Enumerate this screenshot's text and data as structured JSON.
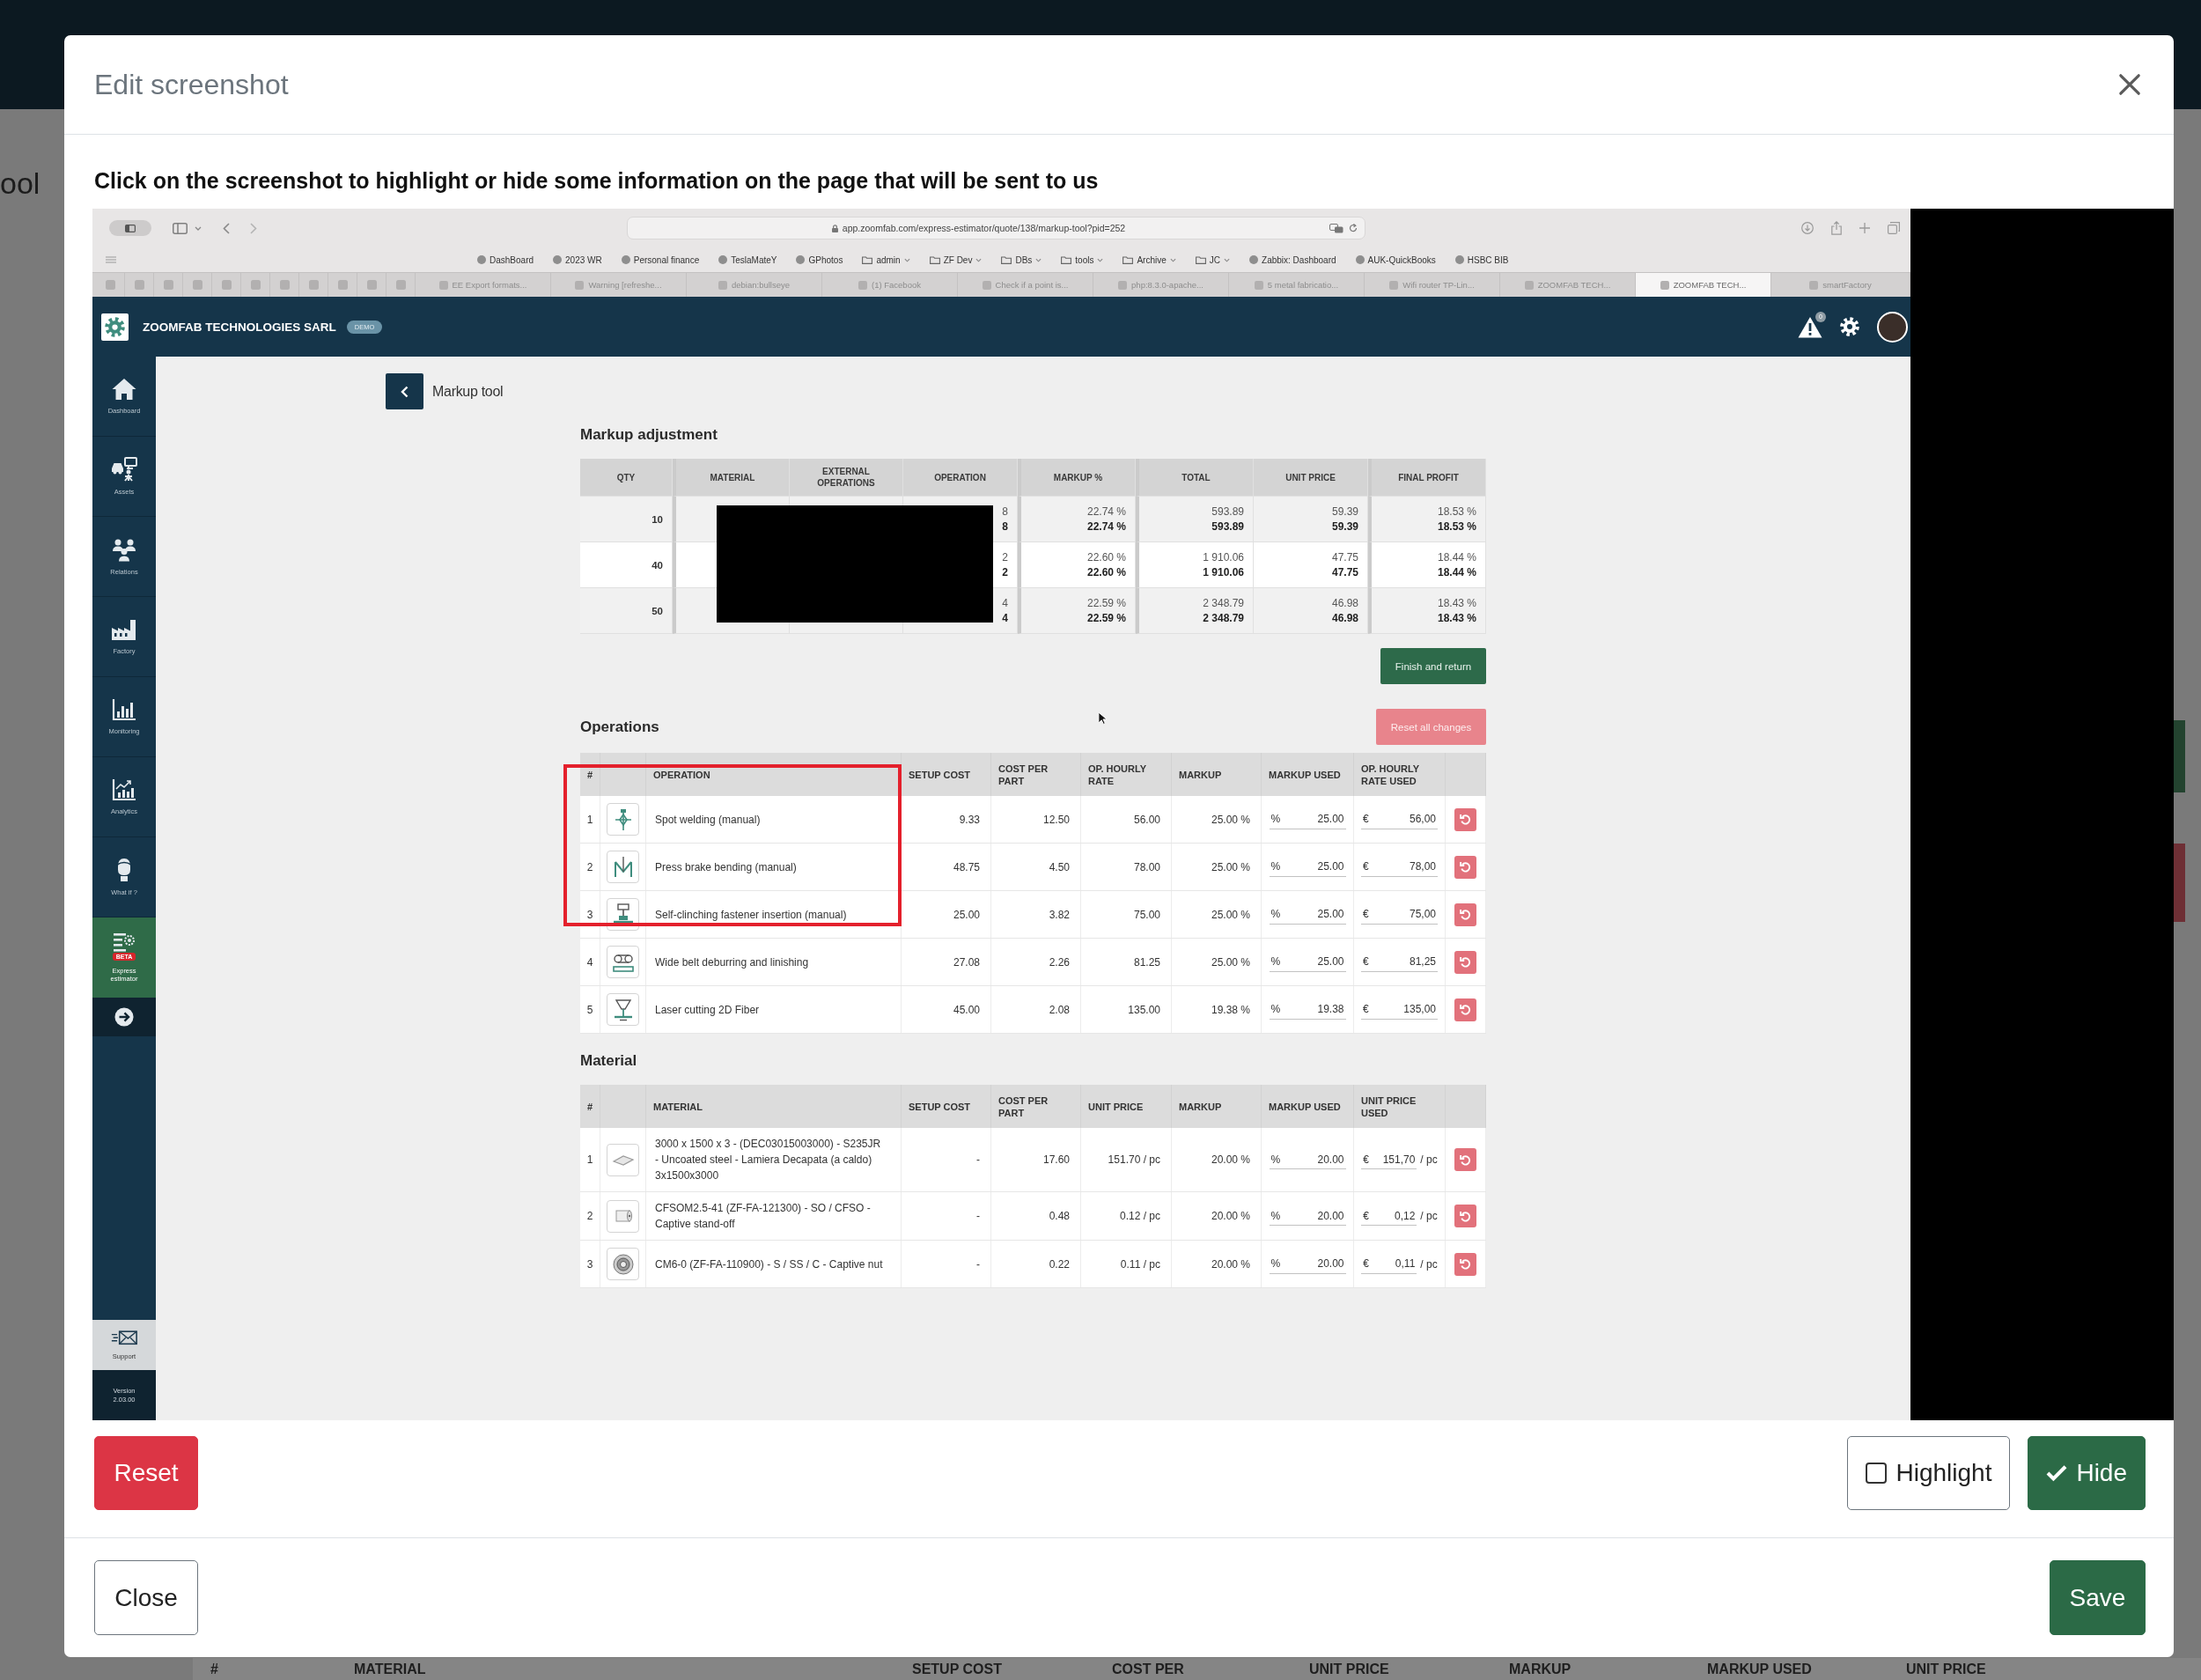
{
  "background_page": {
    "title_fragment": "ool",
    "table_headers": [
      "#",
      "MATERIAL",
      "SETUP COST",
      "COST PER",
      "UNIT PRICE",
      "MARKUP",
      "MARKUP USED",
      "UNIT PRICE"
    ]
  },
  "dialog": {
    "title": "Edit screenshot",
    "instruction": "Click on the screenshot to highlight or hide some information on the page that will be sent to us",
    "reset": "Reset",
    "modes": [
      {
        "label": "Highlight",
        "selected": false
      },
      {
        "label": "Hide",
        "selected": true
      }
    ],
    "close": "Close",
    "save": "Save"
  },
  "browser": {
    "url": "app.zoomfab.com/express-estimator/quote/138/markup-tool?pid=252",
    "bookmarks": [
      {
        "label": "DashBoard",
        "kind": "site"
      },
      {
        "label": "2023 WR",
        "kind": "site"
      },
      {
        "label": "Personal finance",
        "kind": "site"
      },
      {
        "label": "TeslaMateY",
        "kind": "site"
      },
      {
        "label": "GPhotos",
        "kind": "site"
      },
      {
        "label": "admin",
        "kind": "folder"
      },
      {
        "label": "ZF Dev",
        "kind": "folder"
      },
      {
        "label": "DBs",
        "kind": "folder"
      },
      {
        "label": "tools",
        "kind": "folder"
      },
      {
        "label": "Archive",
        "kind": "folder"
      },
      {
        "label": "JC",
        "kind": "folder"
      },
      {
        "label": "Zabbix: Dashboard",
        "kind": "site"
      },
      {
        "label": "AUK-QuickBooks",
        "kind": "site"
      },
      {
        "label": "HSBC BIB",
        "kind": "site"
      }
    ],
    "pinned_tabs": [
      {
        "selected": false
      },
      {
        "selected": false
      },
      {
        "selected": false
      },
      {
        "selected": false
      },
      {
        "selected": false
      },
      {
        "selected": false
      },
      {
        "selected": false
      },
      {
        "selected": false
      },
      {
        "selected": false
      },
      {
        "selected": false
      },
      {
        "selected": false
      }
    ],
    "tabs": [
      {
        "label": "EE Export formats...",
        "selected": false
      },
      {
        "label": "Warning [refreshe...",
        "selected": false
      },
      {
        "label": "debian:bullseye",
        "selected": false
      },
      {
        "label": "(1) Facebook",
        "selected": false
      },
      {
        "label": "Check if a point is...",
        "selected": false
      },
      {
        "label": "php:8.3.0-apache...",
        "selected": false
      },
      {
        "label": "5 metal fabricatio...",
        "selected": false
      },
      {
        "label": "Wifi router TP-Lin...",
        "selected": false
      },
      {
        "label": "ZOOMFAB TECH...",
        "selected": false
      },
      {
        "label": "ZOOMFAB TECH...",
        "selected": true
      },
      {
        "label": "smartFactory",
        "selected": false
      }
    ]
  },
  "app": {
    "company": "ZOOMFAB TECHNOLOGIES SARL",
    "badge": "DEMO",
    "notification_count": "0",
    "sidebar": [
      {
        "label": "Dashboard",
        "selected": false
      },
      {
        "label": "Assets",
        "selected": false
      },
      {
        "label": "Relations",
        "selected": false
      },
      {
        "label": "Factory",
        "selected": false
      },
      {
        "label": "Monitoring",
        "selected": false
      },
      {
        "label": "Analytics",
        "selected": false
      },
      {
        "label": "What if ?",
        "selected": false
      },
      {
        "label": "Express estimator",
        "badge": "BETA",
        "selected": true
      }
    ],
    "support": "Support",
    "version": "Version 2.03.00"
  },
  "page": {
    "back_label": "Markup tool",
    "markup_adjustment": {
      "title": "Markup adjustment",
      "redacted": true,
      "columns": [
        "QTY",
        "MATERIAL",
        "EXTERNAL OPERATIONS",
        "OPERATION",
        "MARKUP %",
        "TOTAL",
        "UNIT PRICE",
        "FINAL PROFIT"
      ],
      "rows": [
        {
          "qty": "10",
          "operation": [
            "8",
            "8"
          ],
          "markup": [
            "22.74 %",
            "22.74 %"
          ],
          "total": [
            "593.89",
            "593.89"
          ],
          "unit_price": [
            "59.39",
            "59.39"
          ],
          "final_profit": [
            "18.53 %",
            "18.53 %"
          ]
        },
        {
          "qty": "40",
          "operation": [
            "2",
            "2"
          ],
          "markup": [
            "22.60 %",
            "22.60 %"
          ],
          "total": [
            "1 910.06",
            "1 910.06"
          ],
          "unit_price": [
            "47.75",
            "47.75"
          ],
          "final_profit": [
            "18.44 %",
            "18.44 %"
          ]
        },
        {
          "qty": "50",
          "operation": [
            "4",
            "4"
          ],
          "markup": [
            "22.59 %",
            "22.59 %"
          ],
          "total": [
            "2 348.79",
            "2 348.79"
          ],
          "unit_price": [
            "46.98",
            "46.98"
          ],
          "final_profit": [
            "18.43 %",
            "18.43 %"
          ]
        }
      ],
      "finish": "Finish and return"
    },
    "operations": {
      "title": "Operations",
      "reset_all": "Reset all changes",
      "columns": [
        "#",
        "OPERATION",
        "SETUP COST",
        "COST PER PART",
        "OP. HOURLY RATE",
        "MARKUP",
        "MARKUP USED",
        "OP. HOURLY RATE USED"
      ],
      "rows": [
        {
          "index": "1",
          "name": "Spot welding (manual)",
          "setup_cost": "9.33",
          "cost_per_part": "12.50",
          "hourly_rate": "56.00",
          "markup": "25.00 %",
          "markup_unit": "%",
          "markup_used": "25.00",
          "rate_unit": "€",
          "rate_used": "56,00",
          "highlighted": true
        },
        {
          "index": "2",
          "name": "Press brake bending (manual)",
          "setup_cost": "48.75",
          "cost_per_part": "4.50",
          "hourly_rate": "78.00",
          "markup": "25.00 %",
          "markup_unit": "%",
          "markup_used": "25.00",
          "rate_unit": "€",
          "rate_used": "78,00",
          "highlighted": true
        },
        {
          "index": "3",
          "name": "Self-clinching fastener insertion (manual)",
          "setup_cost": "25.00",
          "cost_per_part": "3.82",
          "hourly_rate": "75.00",
          "markup": "25.00 %",
          "markup_unit": "%",
          "markup_used": "25.00",
          "rate_unit": "€",
          "rate_used": "75,00",
          "highlighted": true
        },
        {
          "index": "4",
          "name": "Wide belt deburring and linishing",
          "setup_cost": "27.08",
          "cost_per_part": "2.26",
          "hourly_rate": "81.25",
          "markup": "25.00 %",
          "markup_unit": "%",
          "markup_used": "25.00",
          "rate_unit": "€",
          "rate_used": "81,25",
          "highlighted": false
        },
        {
          "index": "5",
          "name": "Laser cutting 2D Fiber",
          "setup_cost": "45.00",
          "cost_per_part": "2.08",
          "hourly_rate": "135.00",
          "markup": "19.38 %",
          "markup_unit": "%",
          "markup_used": "19.38",
          "rate_unit": "€",
          "rate_used": "135,00",
          "highlighted": false
        }
      ]
    },
    "material": {
      "title": "Material",
      "columns": [
        "#",
        "MATERIAL",
        "SETUP COST",
        "COST PER PART",
        "UNIT PRICE",
        "MARKUP",
        "MARKUP USED",
        "UNIT PRICE USED"
      ],
      "rows": [
        {
          "index": "1",
          "name": "3000 x 1500 x 3 - (DEC03015003000) - S235JR - Uncoated steel - Lamiera Decapata (a caldo) 3x1500x3000",
          "setup_cost": "-",
          "cost_per_part": "17.60",
          "unit_price": "151.70 / pc",
          "markup": "20.00 %",
          "markup_unit": "%",
          "markup_used": "20.00",
          "price_unit": "€",
          "price_used": "151,70",
          "per": "/ pc"
        },
        {
          "index": "2",
          "name": "CFSOM2.5-41 (ZF-FA-121300) - SO / CFSO - Captive stand-off",
          "setup_cost": "-",
          "cost_per_part": "0.48",
          "unit_price": "0.12 / pc",
          "markup": "20.00 %",
          "markup_unit": "%",
          "markup_used": "20.00",
          "price_unit": "€",
          "price_used": "0,12",
          "per": "/ pc"
        },
        {
          "index": "3",
          "name": "CM6-0 (ZF-FA-110900) - S / SS / C - Captive nut",
          "setup_cost": "-",
          "cost_per_part": "0.22",
          "unit_price": "0.11 / pc",
          "markup": "20.00 %",
          "markup_unit": "%",
          "markup_used": "20.00",
          "price_unit": "€",
          "price_used": "0,11",
          "per": "/ pc"
        }
      ]
    }
  }
}
